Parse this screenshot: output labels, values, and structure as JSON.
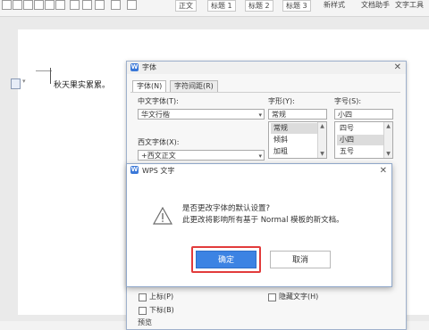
{
  "ribbon": {
    "styles": [
      "正文",
      "标题 1",
      "标题 2",
      "标题 3"
    ],
    "new_style": "新样式",
    "doc_helper": "文档助手",
    "text_tools": "文字工具"
  },
  "document": {
    "text": "秋天果实累累。"
  },
  "font_dialog": {
    "title": "字体",
    "tabs": [
      "字体(N)",
      "字符间距(R)"
    ],
    "chinese_font_label": "中文字体(T):",
    "chinese_font_value": "华文行楷",
    "style_label": "字形(Y):",
    "style_value": "常规",
    "style_options": [
      "常规",
      "倾斜",
      "加粗"
    ],
    "size_label": "字号(S):",
    "size_value": "小四",
    "size_options": [
      "四号",
      "小四",
      "五号"
    ],
    "western_font_label": "西文字体(X):",
    "western_font_value": "+西文正文",
    "effects": {
      "superscript": "上标(P)",
      "subscript": "下标(B)",
      "hidden": "隐藏文字(H)"
    },
    "preview_label": "预览"
  },
  "wps_dialog": {
    "title": "WPS 文字",
    "message_line1": "是否更改字体的默认设置?",
    "message_line2": "此更改将影响所有基于 Normal 模板的新文档。",
    "ok_label": "确定",
    "cancel_label": "取消"
  },
  "colors": {
    "accent": "#3c83e3",
    "highlight_ring": "#e23b3b"
  }
}
